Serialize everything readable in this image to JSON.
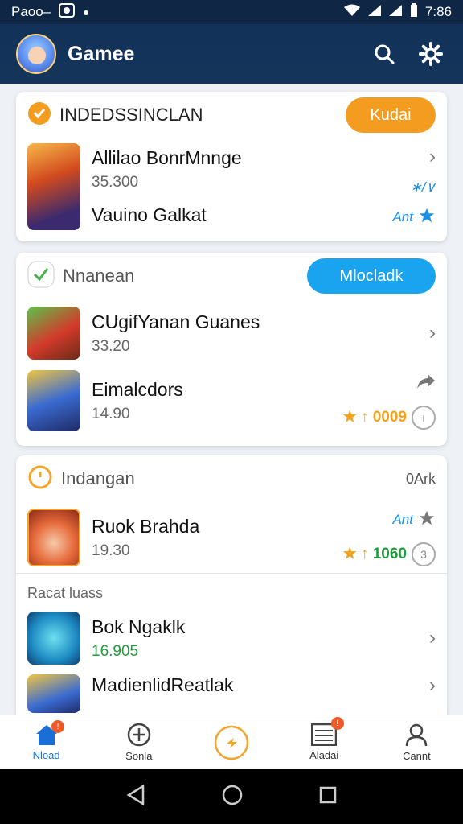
{
  "status_bar": {
    "left_text": "Paoo–",
    "time": "7:86"
  },
  "header": {
    "title": "Gamee"
  },
  "card1": {
    "title": "INDEDSSINCLAN",
    "button": "Kudai",
    "rows": [
      {
        "title": "Allilao BonrMnnge",
        "sub": "35.300",
        "extra": "∗/∨"
      },
      {
        "title": "Vauino Galkat",
        "extra": "Ant"
      }
    ]
  },
  "card2": {
    "title": "Nnanean",
    "button": "Mlocladk",
    "rows": [
      {
        "title": "CUgifYanan Guanes",
        "sub": "33.20"
      },
      {
        "title": "Eimalcdors",
        "sub": "14.90",
        "rating": "0009"
      }
    ]
  },
  "card3": {
    "title": "Indangan",
    "right_text": "0Ark",
    "rows": [
      {
        "title": "Ruok Brahda",
        "sub": "19.30",
        "extra": "Ant",
        "rating": "1060"
      }
    ],
    "section_label": "Racat luass",
    "rows2": [
      {
        "title": "Bok Ngaklk",
        "sub": "16.905"
      },
      {
        "title": "MadienlidReatlak"
      }
    ]
  },
  "bottom_nav": [
    {
      "label": "Nload",
      "icon": "home-icon",
      "badge": "!"
    },
    {
      "label": "Sonla",
      "icon": "plus-circle-icon"
    },
    {
      "label": "",
      "icon": "bolt-icon"
    },
    {
      "label": "Aladai",
      "icon": "list-icon",
      "badge": "!"
    },
    {
      "label": "Cannt",
      "icon": "person-icon"
    }
  ],
  "colors": {
    "header_bg": "#12325a",
    "orange": "#f39c1f",
    "blue": "#1aa3ee",
    "green": "#1e9b3d"
  }
}
